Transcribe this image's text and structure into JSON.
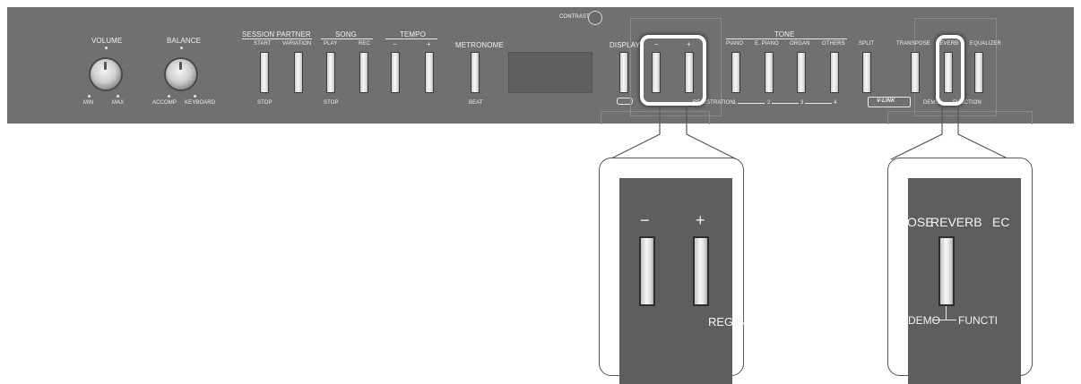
{
  "panel": {
    "contrast_label": "CONTRAST",
    "volume": {
      "label": "VOLUME",
      "min": "MIN",
      "max": "MAX"
    },
    "balance": {
      "label": "BALANCE",
      "left": "ACCOMP",
      "right": "KEYBOARD"
    },
    "session_partner": {
      "label": "SESSION PARTNER",
      "start": "START",
      "variation": "VARIATION",
      "stop": "STOP"
    },
    "song": {
      "label": "SONG",
      "play": "PLAY",
      "rec": "REC",
      "stop": "STOP"
    },
    "tempo": {
      "label": "TEMPO",
      "minus": "−",
      "plus": "+"
    },
    "metronome": {
      "label": "METRONOME",
      "beat": "BEAT"
    },
    "display_btn": "DISPLAY",
    "registration": {
      "minus": "−",
      "plus": "+",
      "label": "REGISTRATION",
      "n1": "1",
      "n2": "2",
      "n3": "3",
      "n4": "4"
    },
    "tone": {
      "label": "TONE",
      "piano": "PIANO",
      "epiano": "E. PIANO",
      "organ": "ORGAN",
      "others": "OTHERS"
    },
    "split": "SPLIT",
    "vlink": "V-LINK",
    "transpose": "TRANSPOSE",
    "reverb": "REVERB",
    "equalizer": "EQUALIZER",
    "demo": "DEMO",
    "function": "FUNCTION"
  },
  "zoom_left": {
    "minus": "−",
    "plus": "+",
    "registration": "REGIS"
  },
  "zoom_right": {
    "prev": "OSE",
    "reverb": "REVERB",
    "next": "EC",
    "demo": "DEMO",
    "function": "FUNCTI"
  }
}
